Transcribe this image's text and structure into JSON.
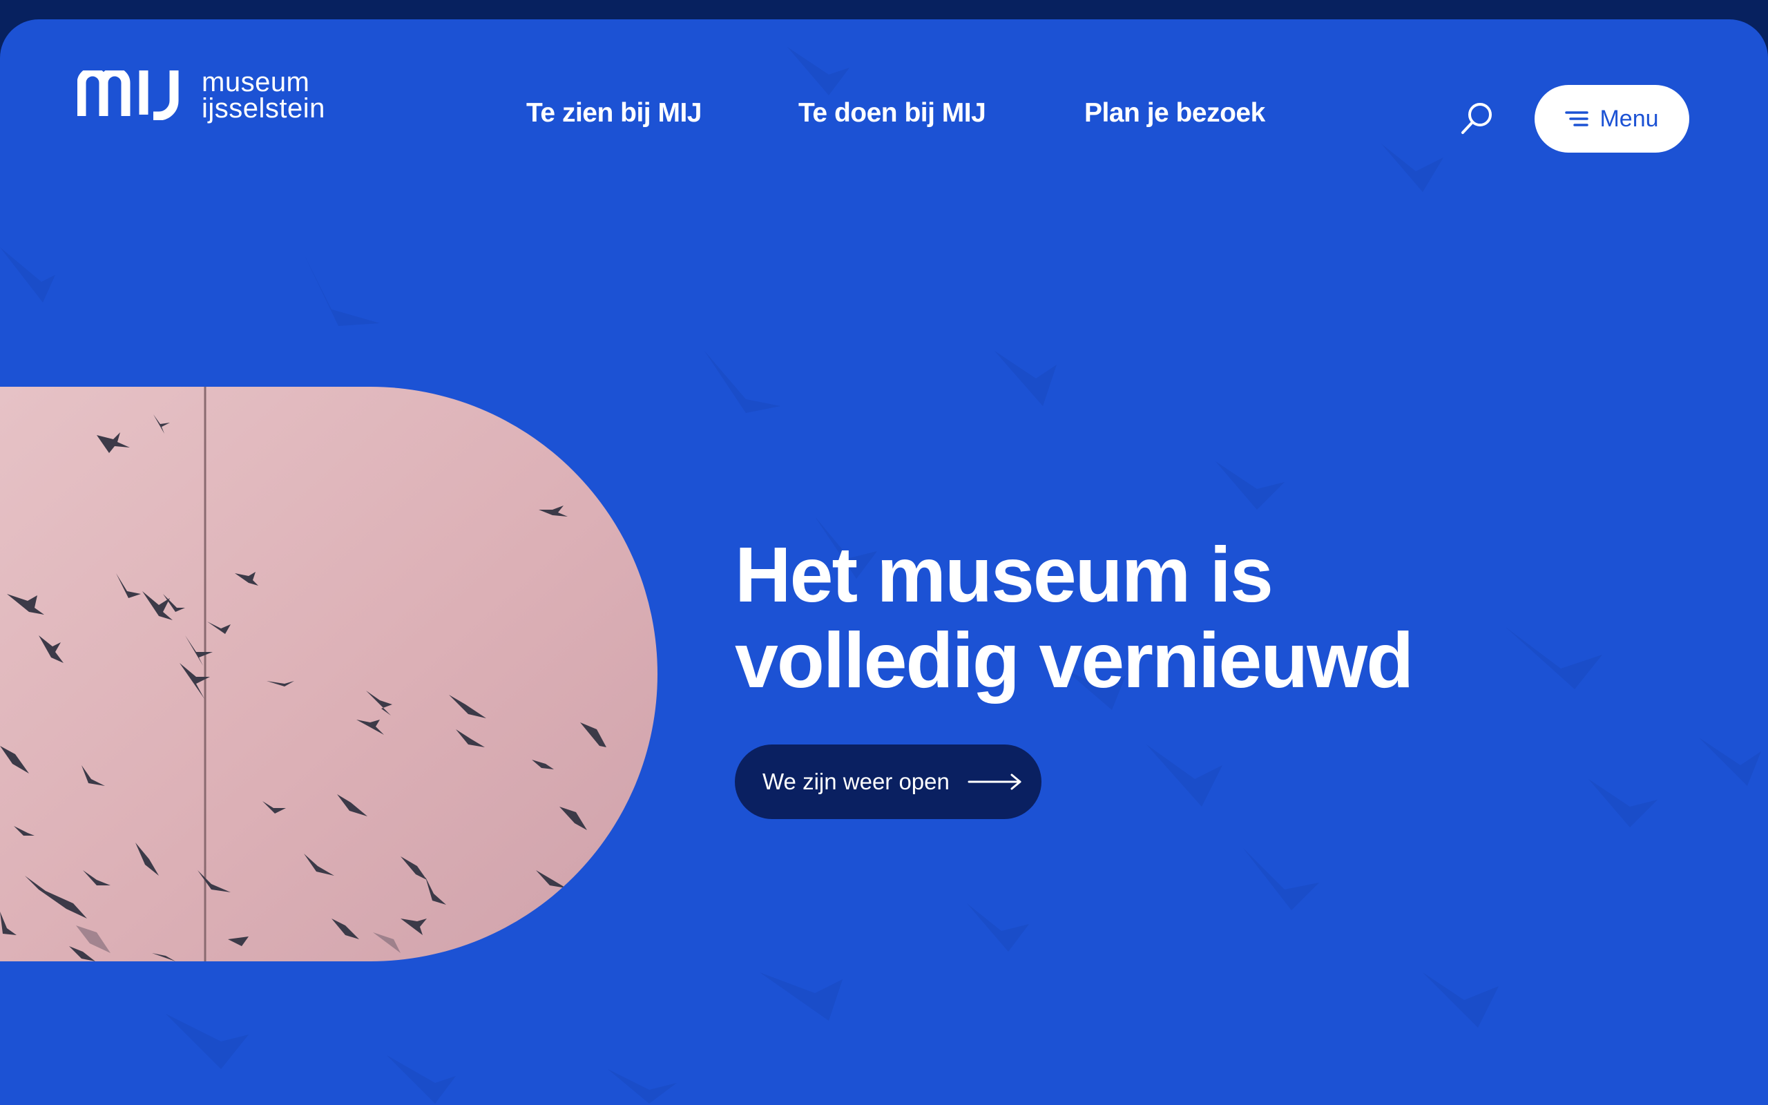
{
  "logo": {
    "mark": "mij",
    "line1": "museum",
    "line2": "ijsselstein"
  },
  "nav": {
    "links": [
      "Te zien bij MIJ",
      "Te doen bij MIJ",
      "Plan je bezoek"
    ]
  },
  "header": {
    "search_icon": "search-icon",
    "menu_label": "Menu",
    "menu_icon": "menu-lines-icon"
  },
  "hero": {
    "title_line1": "Het museum is",
    "title_line2": "volledig vernieuwd",
    "cta_label": "We zijn weer open",
    "cta_icon": "arrow-right-icon"
  },
  "colors": {
    "page_blue": "#1c52d4",
    "frame_navy": "#07215f",
    "cta_navy": "#0a2061",
    "image_pink": "#d9aeb4"
  }
}
